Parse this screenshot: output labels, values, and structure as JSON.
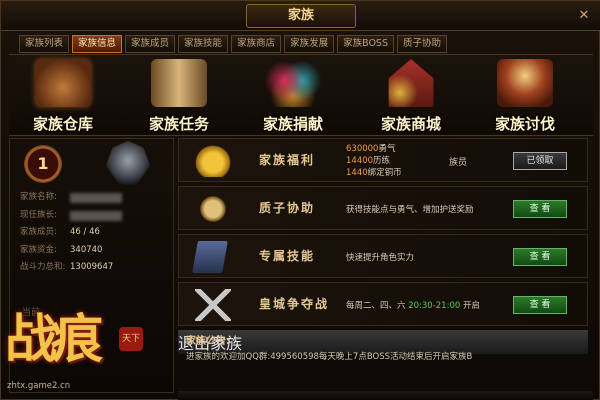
{
  "window": {
    "title": "家族",
    "close_label": "✕"
  },
  "tabs": [
    {
      "label": "家族列表",
      "active": false
    },
    {
      "label": "家族信息",
      "active": true
    },
    {
      "label": "家族成员",
      "active": false
    },
    {
      "label": "家族技能",
      "active": false
    },
    {
      "label": "家族商店",
      "active": false
    },
    {
      "label": "家族发展",
      "active": false
    },
    {
      "label": "家族BOSS",
      "active": false
    },
    {
      "label": "质子协助",
      "active": false
    }
  ],
  "features": [
    {
      "label": "家族仓库"
    },
    {
      "label": "家族任务"
    },
    {
      "label": "家族捐献"
    },
    {
      "label": "家族商城"
    },
    {
      "label": "家族讨伐"
    }
  ],
  "family": {
    "level": "1",
    "fields": [
      {
        "key": "家族名称:",
        "value": ""
      },
      {
        "key": "现任族长:",
        "value": ""
      },
      {
        "key": "家族成员:",
        "value": "46 / 46"
      },
      {
        "key": "家族资金:",
        "value": "340740"
      },
      {
        "key": "战斗力总和:",
        "value": "13009647"
      }
    ]
  },
  "rows": {
    "welfare": {
      "title": "家族福利",
      "lines": [
        {
          "num": "630000",
          "text": "勇气"
        },
        {
          "num": "14400",
          "text": "历练"
        },
        {
          "num": "1440",
          "text": "绑定铜币"
        }
      ],
      "role": "族员",
      "button": "已领取"
    },
    "hostage": {
      "title": "质子协助",
      "desc": "获得技能点与勇气、增加护送奖励",
      "button": "查 看"
    },
    "skill": {
      "title": "专属技能",
      "desc": "快速提升角色实力",
      "button": "查 看"
    },
    "citywar": {
      "title": "皇城争夺战",
      "desc_prefix": "每周二、四、六 ",
      "desc_time": "20:30-21:00",
      "desc_suffix": " 开启",
      "button": "查 看"
    }
  },
  "notice": {
    "title": "家族公告:",
    "text": "进家族的欢迎加QQ群:499560598每天晚上7点BOSS活动结束后开启家族B",
    "quit_button": "退出家族"
  },
  "brand": {
    "logo_text": "战痕",
    "site": "zhtx.game2.cn",
    "ghost_text": "当前"
  }
}
